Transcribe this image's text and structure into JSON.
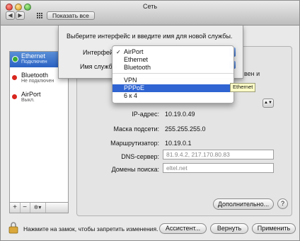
{
  "window": {
    "title": "Сеть",
    "show_all": "Показать все"
  },
  "services": [
    {
      "name": "Ethernet",
      "status": "Подключен",
      "dot_color": "#3aaa35"
    },
    {
      "name": "Bluetooth",
      "status": "Не подключен",
      "dot_color": "#d8261f"
    },
    {
      "name": "AirPort",
      "status": "Выкл.",
      "dot_color": "#d8261f"
    }
  ],
  "sidebar_controls": {
    "add": "+",
    "remove": "−",
    "gear": "✲▾"
  },
  "sheet": {
    "title": "Выберите интерфейс и введите имя для новой службы.",
    "interface_label": "Интерфейс",
    "service_name_label": "Имя службы"
  },
  "menu": {
    "items": [
      {
        "label": "AirPort",
        "checked": true
      },
      {
        "label": "Ethernet",
        "checked": false
      },
      {
        "label": "Bluetooth",
        "checked": false
      },
      {
        "label": "VPN",
        "checked": false
      },
      {
        "label": "PPPoE",
        "checked": false,
        "highlighted": true
      },
      {
        "label": "6 к 4",
        "checked": false
      }
    ],
    "tooltip": "Ethernet"
  },
  "panel": {
    "partial_status": "вен и",
    "ip_label": "IP-адрес:",
    "ip_value": "10.19.0.49",
    "mask_label": "Маска подсети:",
    "mask_value": "255.255.255.0",
    "router_label": "Маршрутизатор:",
    "router_value": "10.19.0.1",
    "dns_label": "DNS-сервер:",
    "dns_value": "81.9.4.2, 217.170.80.83",
    "domains_label": "Домены поиска:",
    "domains_value": "eltel.net",
    "advanced_button": "Дополнительно...",
    "help_button": "?"
  },
  "bottom": {
    "lock_text": "Нажмите на замок, чтобы запретить изменения.",
    "assistant_button": "Ассистент...",
    "revert_button": "Вернуть",
    "apply_button": "Применить"
  },
  "colors": {
    "selection": "#2f64d2",
    "connected": "#3aaa35",
    "disconnected": "#d8261f"
  }
}
